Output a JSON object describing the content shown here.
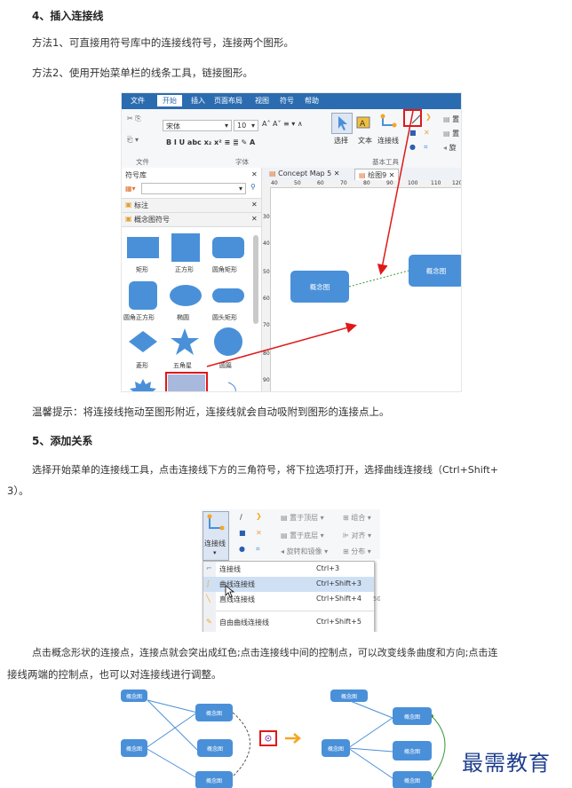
{
  "section4": {
    "heading": "4、插入连接线",
    "method1": "方法1、可直接用符号库中的连接线符号，连接两个图形。",
    "method2": "方法2、使用开始菜单栏的线条工具，链接图形。"
  },
  "figure1": {
    "ribbon_tabs": [
      "文件",
      "开始",
      "插入",
      "页面布局",
      "视图",
      "符号",
      "帮助"
    ],
    "font_name": "宋体",
    "font_size": "10",
    "group_labels": {
      "file": "文件",
      "font": "字体",
      "basic_tools": "基本工具"
    },
    "tool_labels": {
      "select": "选择",
      "text": "文本",
      "connector": "连接线"
    },
    "right_labels": [
      "置",
      "置",
      "旋"
    ],
    "symbol_library_title": "符号库",
    "library_sections": [
      "标注",
      "概念图符号"
    ],
    "shapes": [
      "矩形",
      "正方形",
      "圆角矩形",
      "圆角正方形",
      "椭圆",
      "圆头矩形",
      "菱形",
      "五角星",
      "圆篇"
    ],
    "doc_tabs": [
      "Concept Map 5",
      "绘图9"
    ],
    "ruler_top": [
      "40",
      "50",
      "60",
      "70",
      "80",
      "90",
      "100",
      "110",
      "120"
    ],
    "ruler_left": [
      "30",
      "40",
      "50",
      "60",
      "70",
      "80",
      "90"
    ],
    "node_label": "概念图",
    "colors": {
      "accent": "#2b6cb0",
      "shape": "#4a90d9",
      "highlight": "#e01818"
    }
  },
  "tip": "温馨提示：将连接线拖动至图形附近，连接线就会自动吸附到图形的连接点上。",
  "section5": {
    "heading": "5、添加关系",
    "para_line1": "选择开始菜单的连接线工具，点击连接线下方的三角符号，将下拉选项打开，选择曲线连接线（Ctrl+Shift+",
    "para_line2": "3）。"
  },
  "figure2": {
    "connector_label": "连接线",
    "toolbar_items": [
      "置于顶层",
      "组合",
      "置于底层",
      "对齐",
      "旋转和镜像",
      "分布"
    ],
    "menu": [
      {
        "label": "连接线",
        "shortcut": "Ctrl+3"
      },
      {
        "label": "曲线连接线",
        "shortcut": "Ctrl+Shift+3"
      },
      {
        "label": "直线连接线",
        "shortcut": "Ctrl+Shift+4"
      },
      {
        "label": "自由曲线连接线",
        "shortcut": "Ctrl+Shift+5"
      }
    ],
    "side_value": "50"
  },
  "para3": {
    "line1": "点击概念形状的连接点，连接点就会突出成红色;点击连接线中间的控制点，可以改变线条曲度和方向;点击连",
    "line2": "接线两端的控制点，也可以对连接线进行调整。"
  },
  "figure3": {
    "node_label": "概念图",
    "arrow_color": "#f5a623"
  },
  "watermark": "最需教育"
}
